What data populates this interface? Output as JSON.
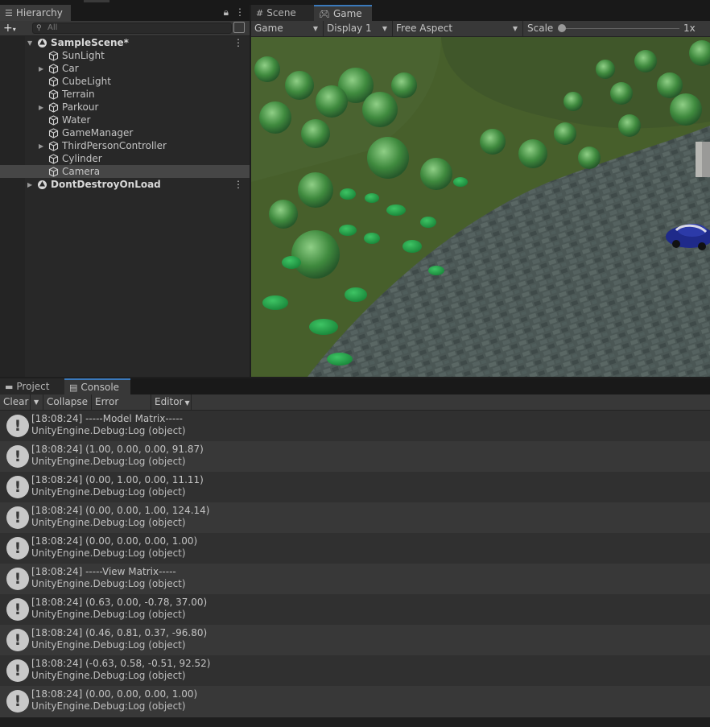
{
  "hierarchy": {
    "tab_label": "Hierarchy",
    "search_placeholder": "All",
    "items": [
      {
        "label": "SampleScene*",
        "depth": 0,
        "expanded": true,
        "scene": true
      },
      {
        "label": "SunLight",
        "depth": 1
      },
      {
        "label": "Car",
        "depth": 1,
        "has_children": true
      },
      {
        "label": "CubeLight",
        "depth": 1
      },
      {
        "label": "Terrain",
        "depth": 1
      },
      {
        "label": "Parkour",
        "depth": 1,
        "has_children": true
      },
      {
        "label": "Water",
        "depth": 1
      },
      {
        "label": "GameManager",
        "depth": 1
      },
      {
        "label": "ThirdPersonController",
        "depth": 1,
        "has_children": true
      },
      {
        "label": "Cylinder",
        "depth": 1
      },
      {
        "label": "Camera",
        "depth": 1,
        "selected": true
      },
      {
        "label": "DontDestroyOnLoad",
        "depth": 0,
        "expanded": false,
        "scene": true
      }
    ]
  },
  "game": {
    "tabs": [
      {
        "label": "Scene",
        "icon": "grid-icon",
        "active": false
      },
      {
        "label": "Game",
        "icon": "gamepad-icon",
        "active": true
      }
    ],
    "toolbar": {
      "mode": "Game",
      "display": "Display 1",
      "aspect": "Free Aspect",
      "scale_label": "Scale",
      "scale_value": "1x"
    }
  },
  "console": {
    "tabs": [
      {
        "label": "Project",
        "icon": "folder-icon",
        "active": false
      },
      {
        "label": "Console",
        "icon": "console-icon",
        "active": true
      }
    ],
    "toolbar": {
      "clear": "Clear",
      "collapse": "Collapse",
      "error_pause": "Error Pause",
      "editor": "Editor"
    },
    "entries": [
      {
        "line1": "[18:08:24] -----Model Matrix-----",
        "line2": "UnityEngine.Debug:Log (object)"
      },
      {
        "line1": "[18:08:24] (1.00, 0.00, 0.00, 91.87)",
        "line2": "UnityEngine.Debug:Log (object)"
      },
      {
        "line1": "[18:08:24] (0.00, 1.00, 0.00, 11.11)",
        "line2": "UnityEngine.Debug:Log (object)"
      },
      {
        "line1": "[18:08:24] (0.00, 0.00, 1.00, 124.14)",
        "line2": "UnityEngine.Debug:Log (object)"
      },
      {
        "line1": "[18:08:24] (0.00, 0.00, 0.00, 1.00)",
        "line2": "UnityEngine.Debug:Log (object)"
      },
      {
        "line1": "[18:08:24] -----View Matrix-----",
        "line2": "UnityEngine.Debug:Log (object)"
      },
      {
        "line1": "[18:08:24] (0.63, 0.00, -0.78, 37.00)",
        "line2": "UnityEngine.Debug:Log (object)"
      },
      {
        "line1": "[18:08:24] (0.46, 0.81, 0.37, -96.80)",
        "line2": "UnityEngine.Debug:Log (object)"
      },
      {
        "line1": "[18:08:24] (-0.63, 0.58, -0.51, 92.52)",
        "line2": "UnityEngine.Debug:Log (object)"
      },
      {
        "line1": "[18:08:24] (0.00, 0.00, 0.00, 1.00)",
        "line2": "UnityEngine.Debug:Log (object)"
      }
    ]
  },
  "colors": {
    "accent": "#3a79bb",
    "panel": "#282828",
    "toolbar": "#383838",
    "grass": "#475f2b",
    "rock": "#4a5553",
    "car": "#1f2a8a"
  }
}
